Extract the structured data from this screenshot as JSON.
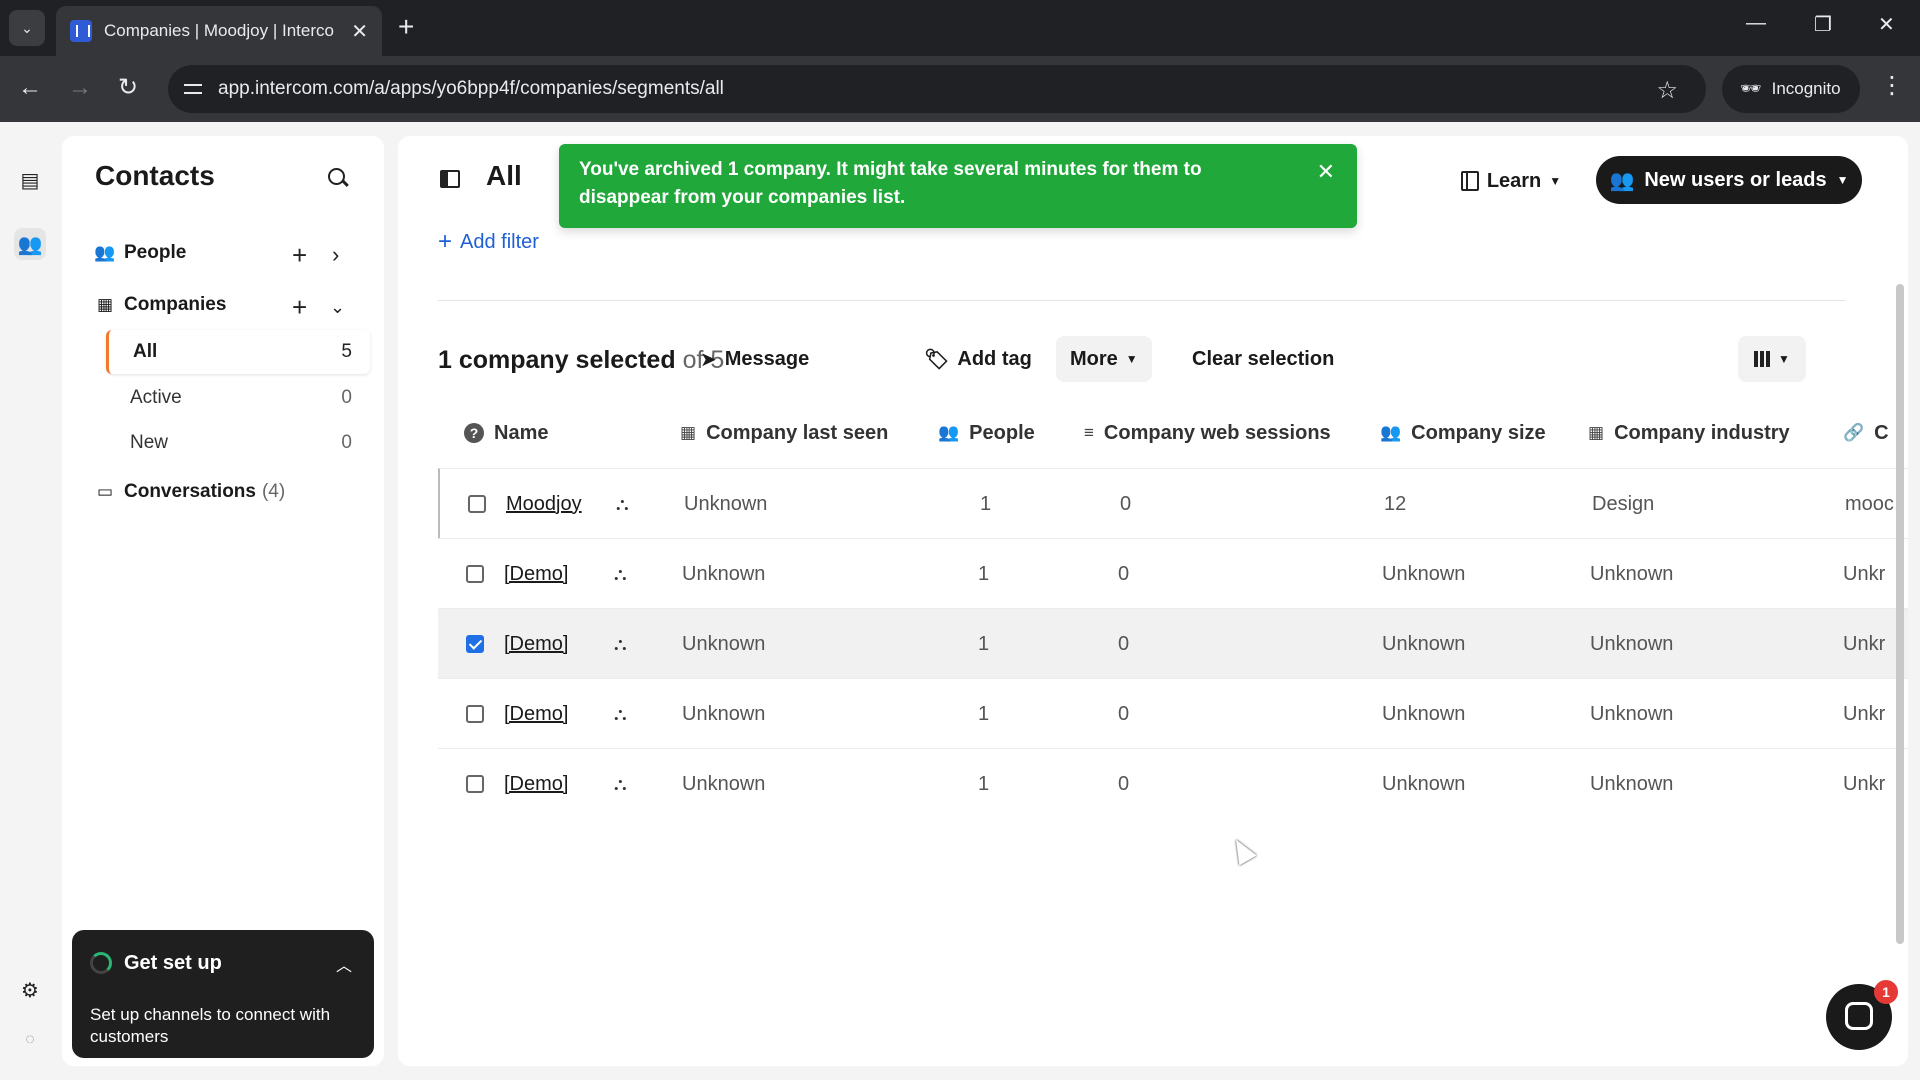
{
  "browser": {
    "tab_title": "Companies | Moodjoy | Interco",
    "url": "app.intercom.com/a/apps/yo6bpp4f/companies/segments/all",
    "incognito_label": "Incognito"
  },
  "sidebar": {
    "title": "Contacts",
    "people_label": "People",
    "companies_label": "Companies",
    "segments": [
      {
        "label": "All",
        "count": "5"
      },
      {
        "label": "Active",
        "count": "0"
      },
      {
        "label": "New",
        "count": "0"
      }
    ],
    "conversations_label": "Conversations",
    "conversations_count": "(4)"
  },
  "setup_card": {
    "title": "Get set up",
    "text": "Set up channels to connect with customers"
  },
  "main": {
    "view_title": "All",
    "add_filter": "Add filter",
    "learn_label": "Learn",
    "new_users_label": "New users or leads",
    "toast": "You've archived 1 company. It might take several minutes for them to disappear from your companies list.",
    "selection_text": "1 company selected",
    "selection_of": "of 5",
    "toolbar": {
      "message": "Message",
      "add_tag": "Add tag",
      "more": "More",
      "clear": "Clear selection"
    }
  },
  "table": {
    "columns": [
      "Name",
      "Company last seen",
      "People",
      "Company web sessions",
      "Company size",
      "Company industry",
      "C"
    ],
    "rows": [
      {
        "name": "Moodjoy",
        "last_seen": "Unknown",
        "people": "1",
        "sessions": "0",
        "size": "12",
        "industry": "Design",
        "extra": "mooc",
        "checked": false
      },
      {
        "name": "[Demo]",
        "last_seen": "Unknown",
        "people": "1",
        "sessions": "0",
        "size": "Unknown",
        "industry": "Unknown",
        "extra": "Unkr",
        "checked": false
      },
      {
        "name": "[Demo]",
        "last_seen": "Unknown",
        "people": "1",
        "sessions": "0",
        "size": "Unknown",
        "industry": "Unknown",
        "extra": "Unkr",
        "checked": true
      },
      {
        "name": "[Demo]",
        "last_seen": "Unknown",
        "people": "1",
        "sessions": "0",
        "size": "Unknown",
        "industry": "Unknown",
        "extra": "Unkr",
        "checked": false
      },
      {
        "name": "[Demo]",
        "last_seen": "Unknown",
        "people": "1",
        "sessions": "0",
        "size": "Unknown",
        "industry": "Unknown",
        "extra": "Unkr",
        "checked": false
      }
    ]
  },
  "messenger_badge": "1"
}
